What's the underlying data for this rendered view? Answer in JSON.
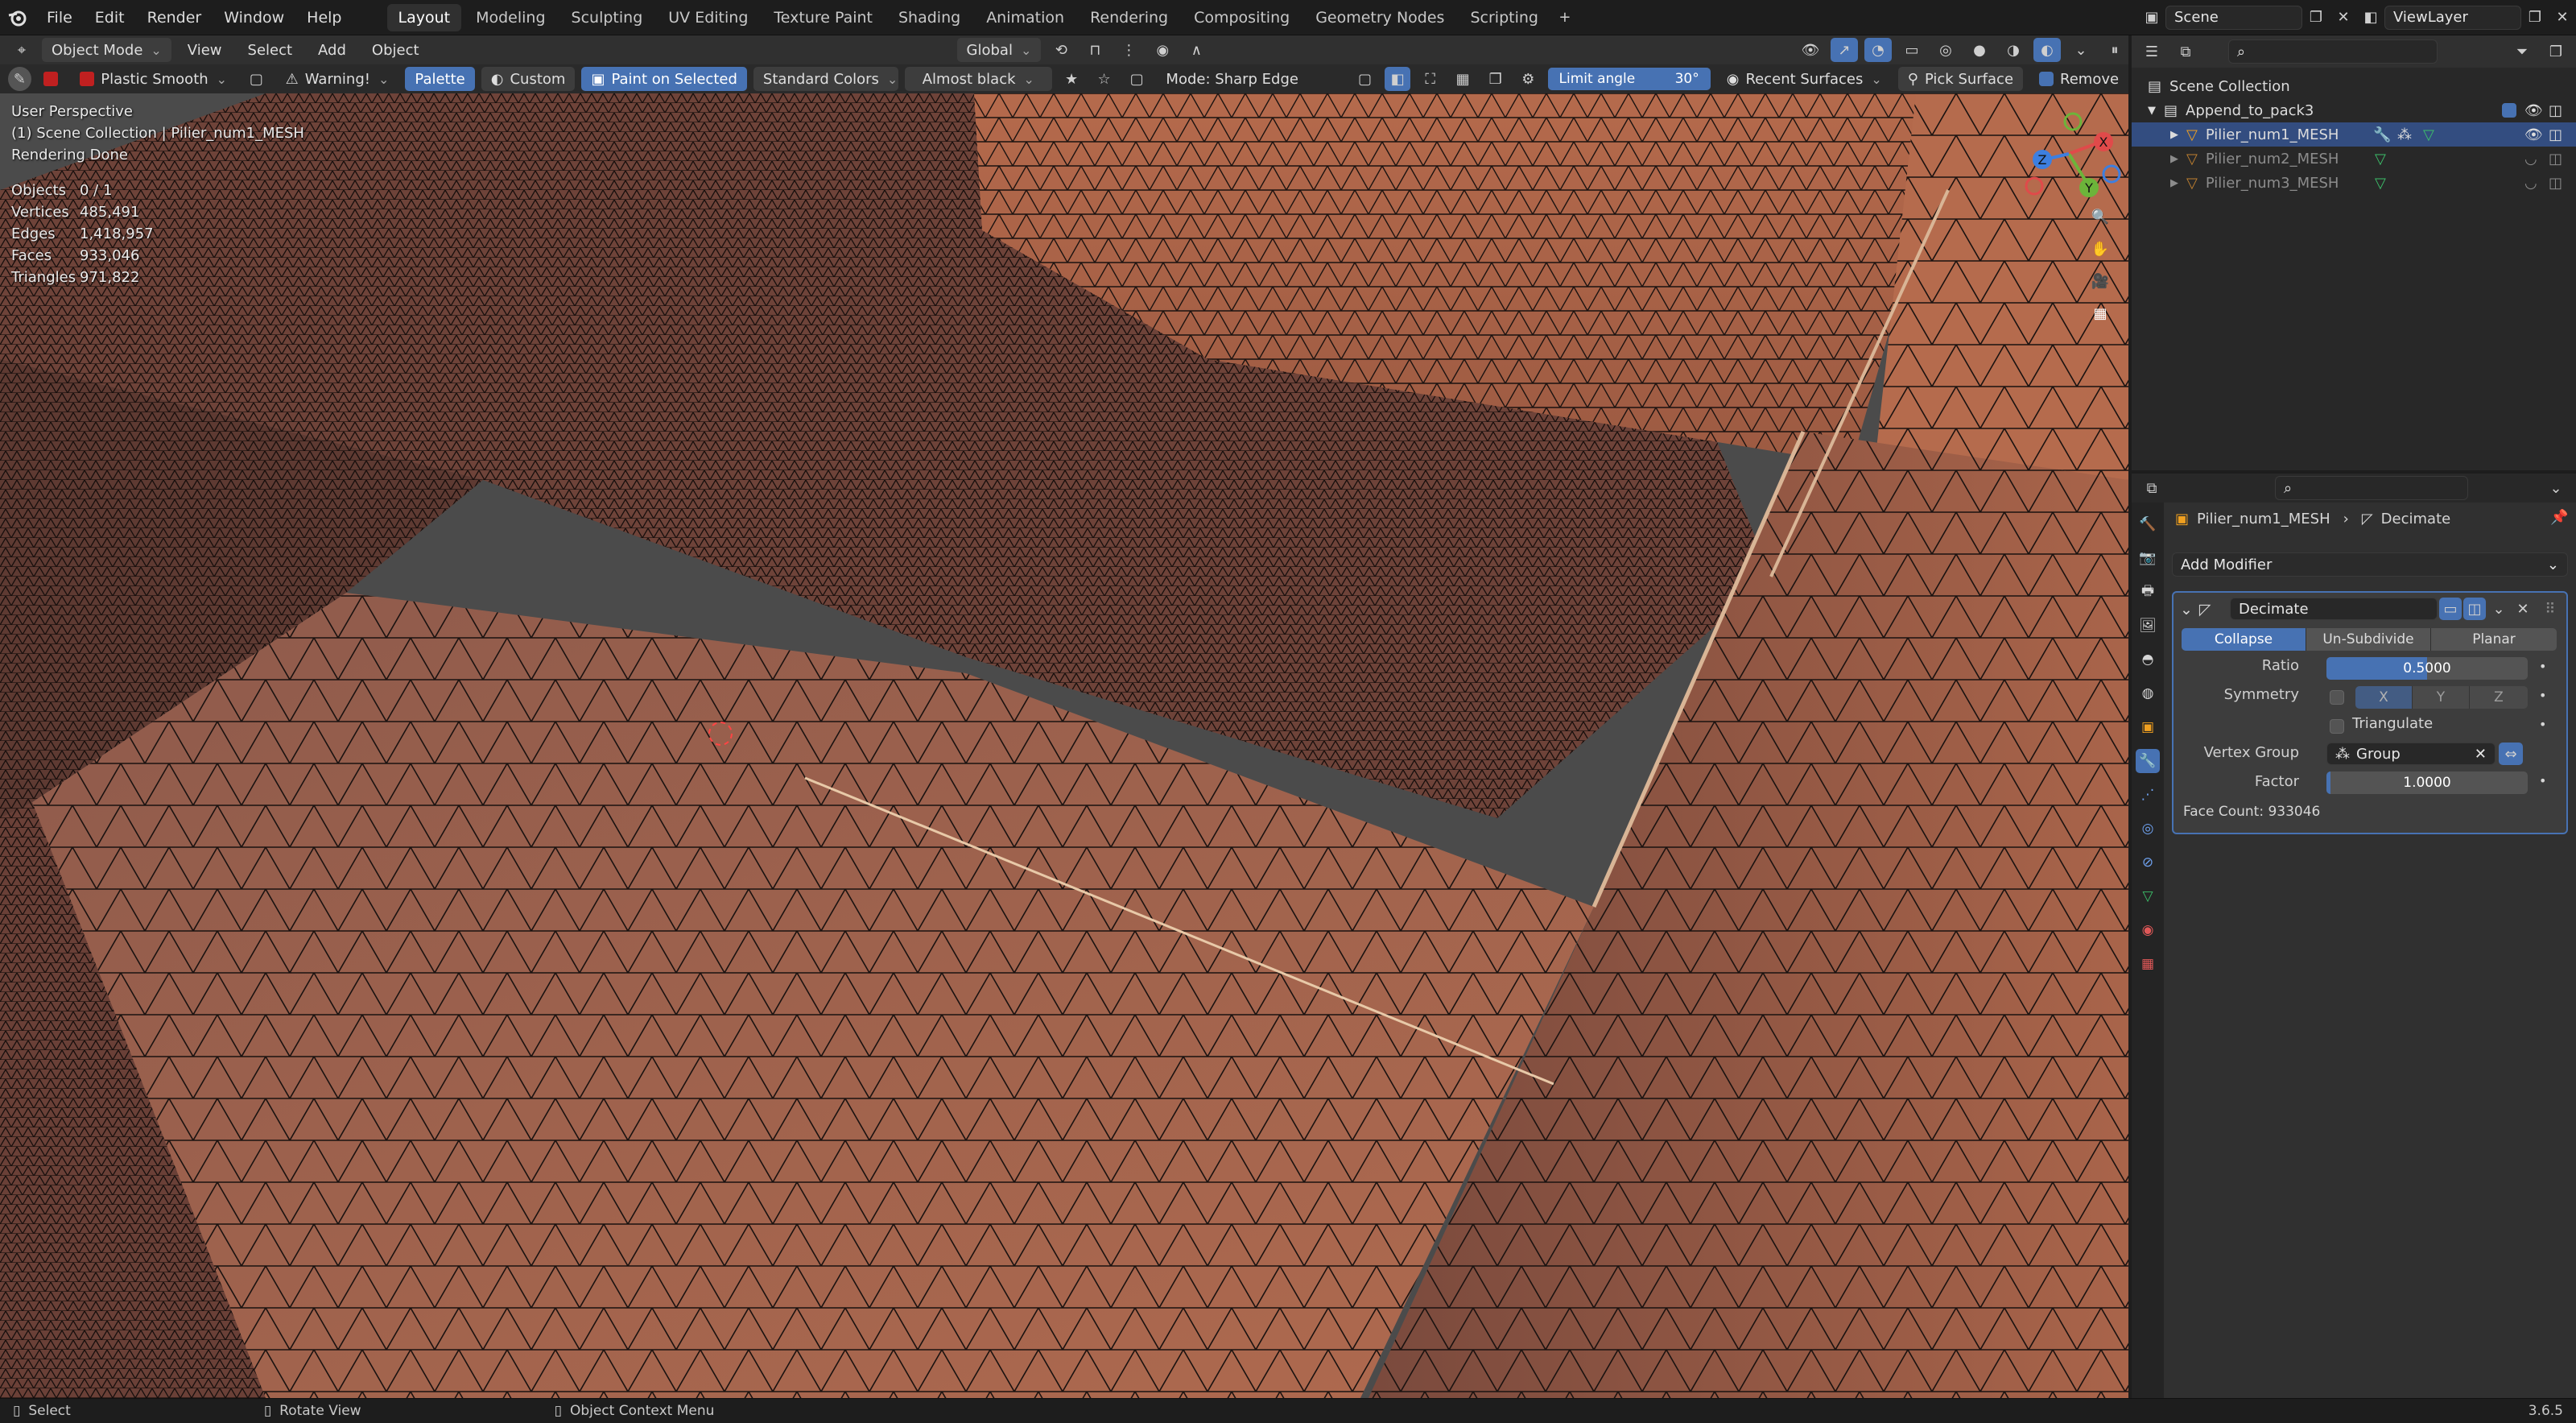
{
  "app": {
    "menu": [
      "File",
      "Edit",
      "Render",
      "Window",
      "Help"
    ],
    "workspaces": [
      "Layout",
      "Modeling",
      "Sculpting",
      "UV Editing",
      "Texture Paint",
      "Shading",
      "Animation",
      "Rendering",
      "Compositing",
      "Geometry Nodes",
      "Scripting"
    ],
    "active_workspace": "Layout",
    "scene_name": "Scene",
    "view_layer": "ViewLayer",
    "version": "3.6.5"
  },
  "header": {
    "mode": "Object Mode",
    "view_menus": [
      "View",
      "Select",
      "Add",
      "Object"
    ],
    "orientation": "Global"
  },
  "tool_header": {
    "brush": "Plastic Smooth",
    "warning": "Warning!",
    "palette": "Palette",
    "custom": "Custom",
    "paint_on_selected": "Paint on Selected",
    "standard_colors": "Standard Colors",
    "color_name": "Almost black",
    "mode_label": "Mode: Sharp Edge",
    "limit_angle_label": "Limit angle",
    "limit_angle_value": "30°",
    "recent_surfaces": "Recent Surfaces",
    "pick_surface": "Pick Surface",
    "remove": "Remove"
  },
  "viewport": {
    "perspective": "User Perspective",
    "collection_line": "(1) Scene Collection | Pilier_num1_MESH",
    "render_status": "Rendering Done",
    "stats": [
      {
        "label": "Objects",
        "value": "0 / 1"
      },
      {
        "label": "Vertices",
        "value": "485,491"
      },
      {
        "label": "Edges",
        "value": "1,418,957"
      },
      {
        "label": "Faces",
        "value": "933,046"
      },
      {
        "label": "Triangles",
        "value": "971,822"
      }
    ],
    "gizmo_axes": [
      "X",
      "Y",
      "Z"
    ]
  },
  "outliner": {
    "root": "Scene Collection",
    "collection": "Append_to_pack3",
    "objects": [
      "Pilier_num1_MESH",
      "Pilier_num2_MESH",
      "Pilier_num3_MESH"
    ]
  },
  "properties": {
    "object_name": "Pilier_num1_MESH",
    "modifier_crumb": "Decimate",
    "add_modifier": "Add Modifier",
    "modifier_name": "Decimate",
    "modes": [
      "Collapse",
      "Un-Subdivide",
      "Planar"
    ],
    "active_mode": "Collapse",
    "ratio_label": "Ratio",
    "ratio_value": "0.5000",
    "ratio": 0.5,
    "symmetry_label": "Symmetry",
    "symmetry_axes": [
      "X",
      "Y",
      "Z"
    ],
    "triangulate_label": "Triangulate",
    "vertex_group_label": "Vertex Group",
    "vertex_group_value": "Group",
    "factor_label": "Factor",
    "factor_value": "1.0000",
    "factor": 0.02,
    "face_count": "Face Count: 933046"
  },
  "statusbar": {
    "select": "Select",
    "rotate": "Rotate View",
    "context": "Object Context Menu"
  },
  "colors": {
    "accent": "#4772b3",
    "mesh": "#a35f48",
    "wire": "#1a1210"
  }
}
